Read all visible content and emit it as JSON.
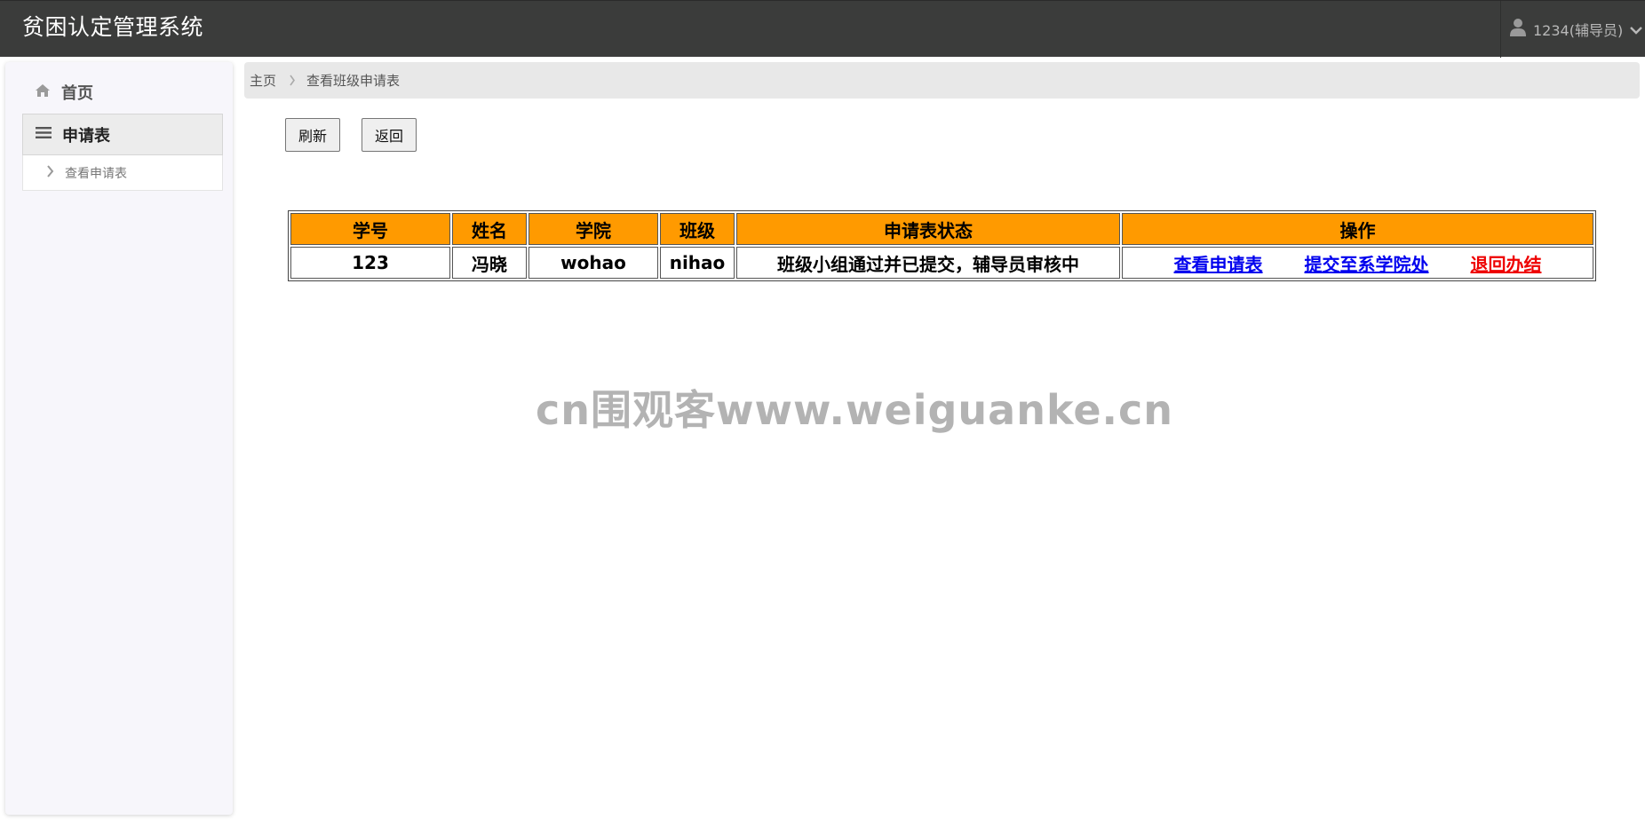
{
  "header": {
    "app_title": "贫困认定管理系统",
    "user_label": "1234(辅导员)"
  },
  "sidebar": {
    "items": [
      {
        "label": "首页",
        "icon": "home-icon"
      },
      {
        "label": "申请表",
        "icon": "menu-icon"
      },
      {
        "label": "查看申请表",
        "icon": "chevron-right-icon"
      }
    ]
  },
  "breadcrumb": {
    "home": "主页",
    "current": "查看班级申请表"
  },
  "toolbar": {
    "refresh_label": "刷新",
    "back_label": "返回"
  },
  "table": {
    "headers": [
      "学号",
      "姓名",
      "学院",
      "班级",
      "申请表状态",
      "操作"
    ],
    "rows": [
      {
        "student_id": "123",
        "name": "冯晓",
        "college": "wohao",
        "class": "nihao",
        "status": "班级小组通过并已提交，辅导员审核中",
        "actions": {
          "view": "查看申请表",
          "submit": "提交至系学院处",
          "return": "退回办结"
        }
      }
    ]
  },
  "watermark": "cn围观客www.weiguanke.cn",
  "colors": {
    "topbar": "#3b3c3b",
    "table_header": "#ff9a00",
    "link_blue": "#0000ee",
    "link_red": "#ee0000"
  }
}
